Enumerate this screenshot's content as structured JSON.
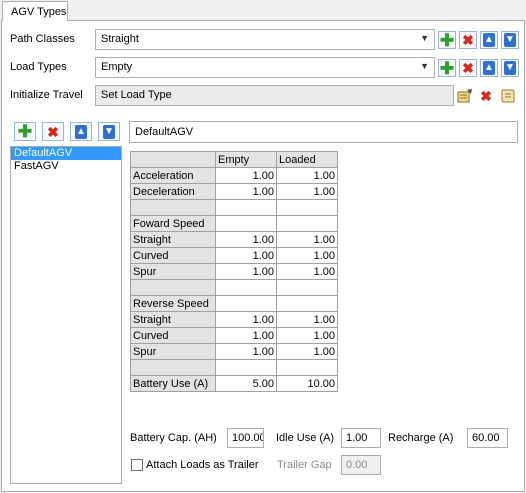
{
  "tab": {
    "label": "AGV Types"
  },
  "path_classes": {
    "label": "Path Classes",
    "value": "Straight"
  },
  "load_types": {
    "label": "Load Types",
    "value": "Empty"
  },
  "initialize_travel": {
    "label": "Initialize Travel",
    "value": "Set Load Type"
  },
  "agv_list": {
    "items": [
      "DefaultAGV",
      "FastAGV"
    ],
    "selected": "DefaultAGV"
  },
  "name_field": {
    "value": "DefaultAGV"
  },
  "grid": {
    "columns": [
      "",
      "Empty",
      "Loaded"
    ],
    "rows": [
      [
        "Acceleration",
        "1.00",
        "1.00"
      ],
      [
        "Deceleration",
        "1.00",
        "1.00"
      ],
      [
        "",
        "",
        ""
      ],
      [
        "Foward Speed",
        "",
        ""
      ],
      [
        "Straight",
        "1.00",
        "1.00"
      ],
      [
        "Curved",
        "1.00",
        "1.00"
      ],
      [
        "Spur",
        "1.00",
        "1.00"
      ],
      [
        "",
        "",
        ""
      ],
      [
        "Reverse Speed",
        "",
        ""
      ],
      [
        "Straight",
        "1.00",
        "1.00"
      ],
      [
        "Curved",
        "1.00",
        "1.00"
      ],
      [
        "Spur",
        "1.00",
        "1.00"
      ],
      [
        "",
        "",
        ""
      ],
      [
        "Battery Use (A)",
        "5.00",
        "10.00"
      ]
    ]
  },
  "battery": {
    "cap_label": "Battery Cap. (AH)",
    "cap_value": "100.00",
    "idle_label": "Idle Use (A)",
    "idle_value": "1.00",
    "recharge_label": "Recharge (A)",
    "recharge_value": "60.00"
  },
  "trailer": {
    "attach_label": "Attach Loads as Trailer",
    "attach_checked": false,
    "gap_label": "Trailer Gap",
    "gap_value": "0.00"
  },
  "icons": {
    "add": "plus-icon",
    "remove": "delete-icon",
    "up": "arrow-up-icon",
    "down": "arrow-down-icon",
    "edit": "edit-icon",
    "script": "script-icon",
    "dropdown": "chevron-down-icon"
  },
  "colors": {
    "selection": "#3399ff",
    "add_green": "#2f9e2f",
    "delete_red": "#d7261d",
    "arrow_blue": "#2f6fd0"
  }
}
